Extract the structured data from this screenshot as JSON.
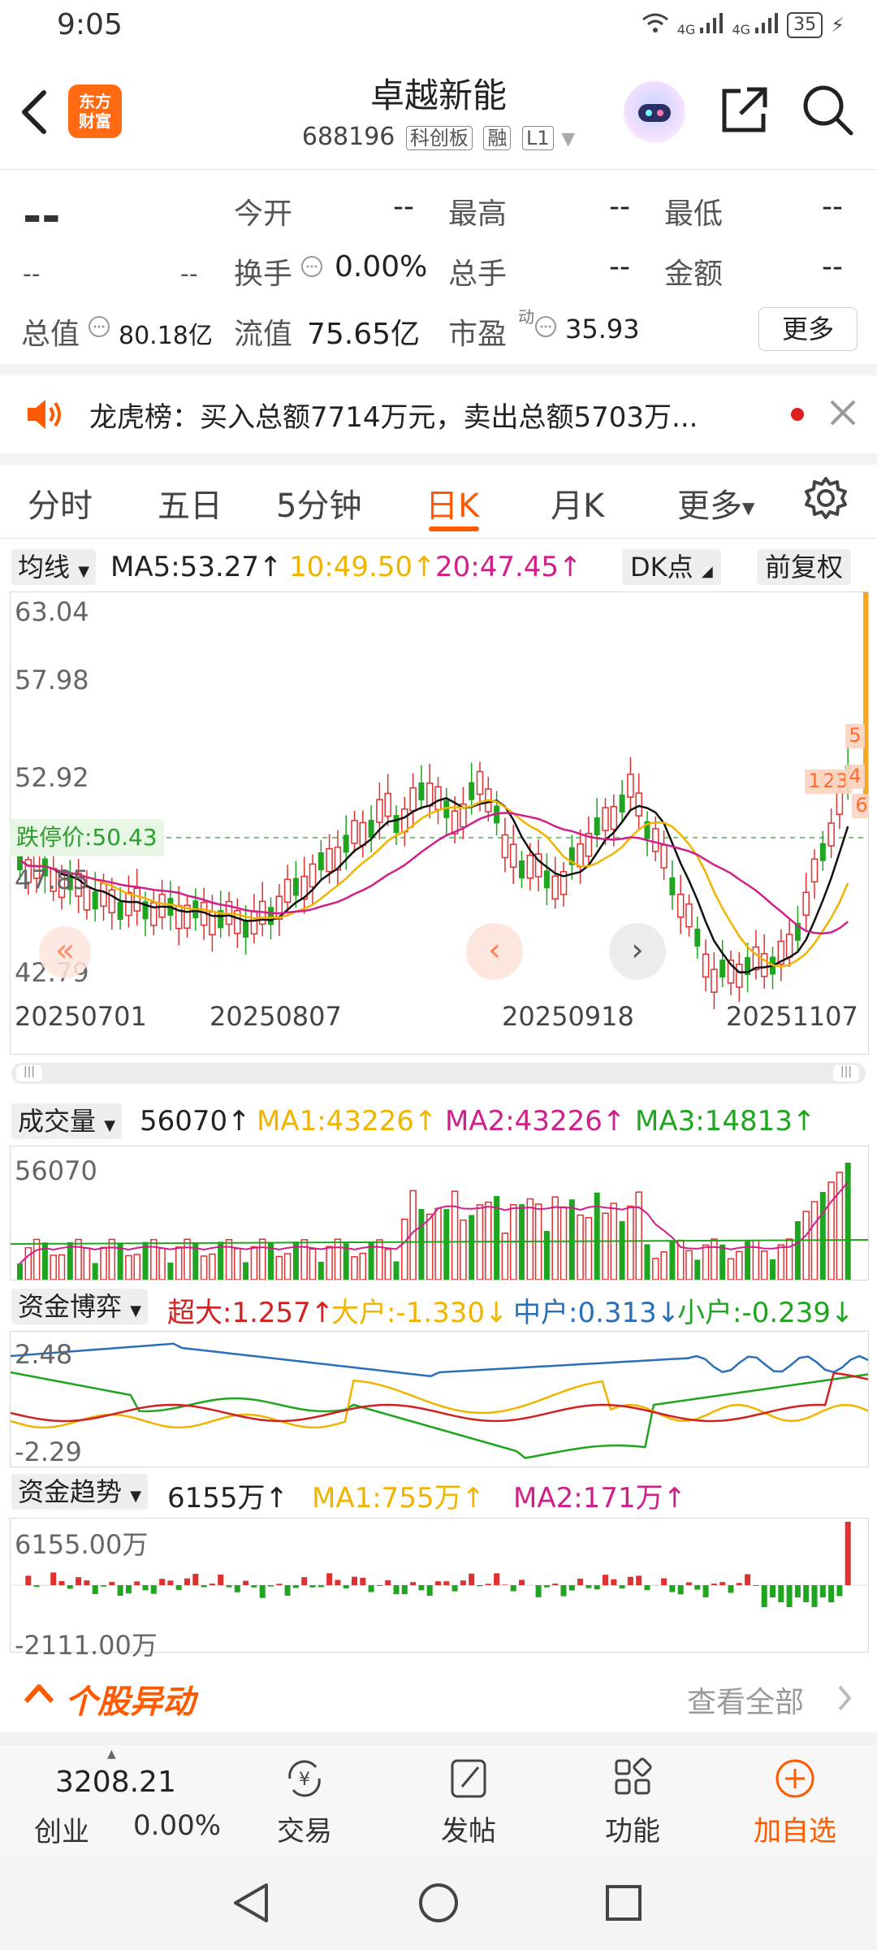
{
  "status_bar": {
    "time": "9:05",
    "net1": "4G",
    "net2": "4G",
    "battery": "35"
  },
  "header": {
    "logo_line1": "东方",
    "logo_line2": "财富",
    "title": "卓越新能",
    "code": "688196",
    "tags": [
      "科创板",
      "融",
      "L1"
    ]
  },
  "quote": {
    "price": "--",
    "change": "--",
    "change_pct": "--",
    "open_label": "今开",
    "open": "--",
    "high_label": "最高",
    "high": "--",
    "low_label": "最低",
    "low": "--",
    "turnover_label": "换手",
    "turnover": "0.00%",
    "volume_label": "总手",
    "volume": "--",
    "amount_label": "金额",
    "amount": "--",
    "mktcap_label": "总值",
    "mktcap": "80.18亿",
    "float_label": "流值",
    "float_cap": "75.65亿",
    "pe_label": "市盈",
    "pe_sup": "动",
    "pe": "35.93",
    "more": "更多"
  },
  "notice": {
    "text": "龙虎榜：买入总额7714万元，卖出总额5703万..."
  },
  "tabs": [
    "分时",
    "五日",
    "5分钟",
    "日K",
    "月K",
    "更多"
  ],
  "ma_bar": {
    "select": "均线",
    "ma5": "MA5:53.27↑",
    "ma10": "10:49.50↑",
    "ma20": "20:47.45↑",
    "dk": "DK点",
    "fq": "前复权"
  },
  "kchart": {
    "y_labels": [
      "63.04",
      "57.98",
      "52.92",
      "47.85",
      "42.79"
    ],
    "limit_label": "跌停价:50.43",
    "dates": [
      "20250701",
      "20250807",
      "20250918",
      "20251107"
    ],
    "markers": [
      "5",
      "1",
      "2",
      "3",
      "4",
      "6"
    ]
  },
  "volume": {
    "select": "成交量",
    "value": "56070↑",
    "ma1": "MA1:43226↑",
    "ma2": "MA2:43226↑",
    "ma3": "MA3:14813↑",
    "top": "56070"
  },
  "fund_game": {
    "select": "资金博弈",
    "super": "超大:1.257↑",
    "large": "大户:-1.330↓",
    "medium": "中户:0.313↓",
    "small": "小户:-0.239↓",
    "top": "2.48",
    "bottom": "-2.29"
  },
  "fund_trend": {
    "select": "资金趋势",
    "value": "6155万↑",
    "ma1": "MA1:755万↑",
    "ma2": "MA2:171万↑",
    "top": "6155.00万",
    "bottom": "-2111.00万"
  },
  "abnormal": {
    "title": "个股异动",
    "view_all": "查看全部"
  },
  "bottom_nav": {
    "index_value": "3208.21",
    "index_name": "创业",
    "index_change": "0.00%",
    "trade": "交易",
    "post": "发帖",
    "function": "功能",
    "add": "加自选"
  },
  "colors": {
    "accent": "#ff5a00",
    "up": "#e03030",
    "down": "#1fa51f",
    "ma5": "#111111",
    "ma10": "#f0b400",
    "ma20": "#d01f8a"
  }
}
